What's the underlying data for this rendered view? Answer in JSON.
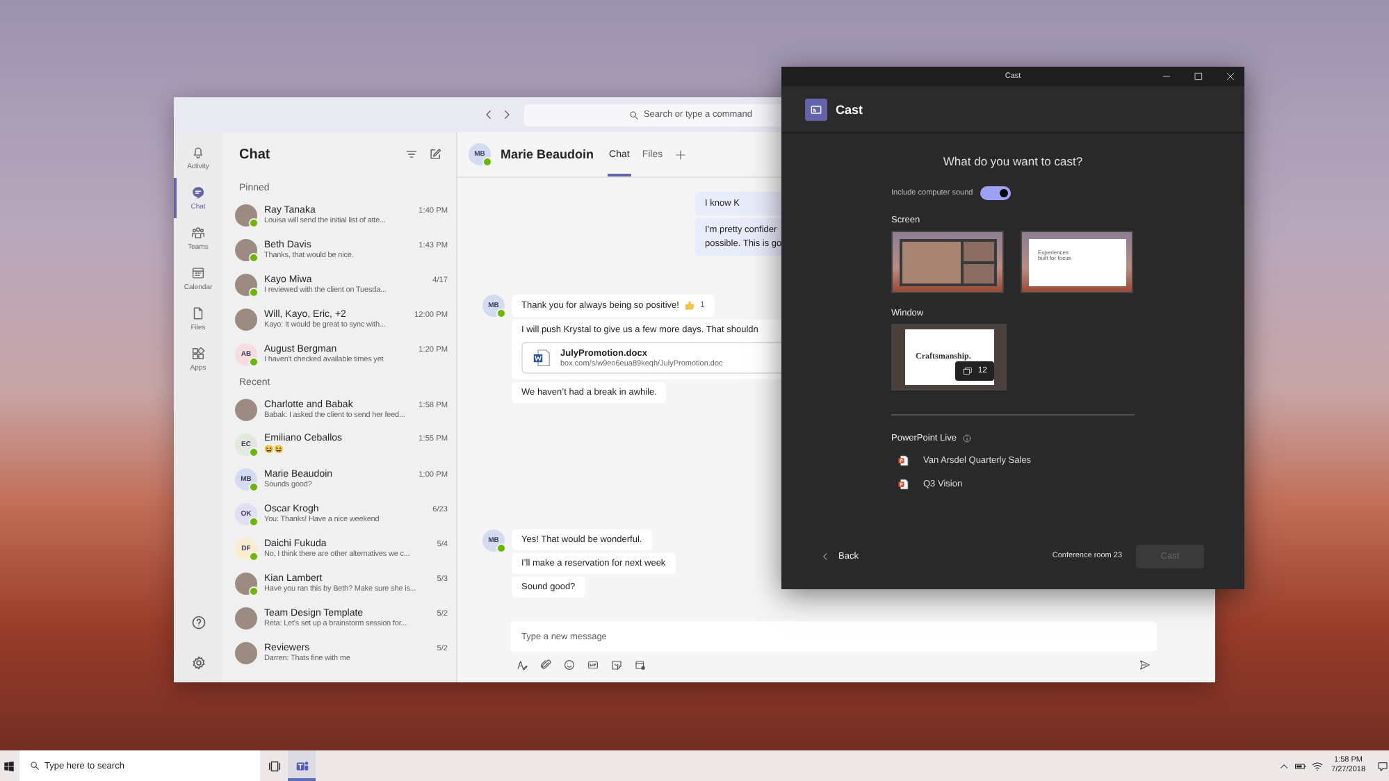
{
  "teams_window": {
    "title_bar": {
      "search_placeholder": "Search or type a command"
    },
    "rail": {
      "items": [
        {
          "label": "Activity",
          "kind": "bell",
          "selected": false
        },
        {
          "label": "Chat",
          "kind": "chat",
          "selected": true
        },
        {
          "label": "Teams",
          "kind": "teams",
          "selected": false
        },
        {
          "label": "Calendar",
          "kind": "calendar",
          "selected": false
        },
        {
          "label": "Files",
          "kind": "file",
          "selected": false
        },
        {
          "label": "Apps",
          "kind": "apps",
          "selected": false
        }
      ],
      "bottom": [
        {
          "kind": "help"
        },
        {
          "kind": "settings"
        }
      ]
    },
    "chat_list": {
      "title": "Chat",
      "sections": [
        {
          "title": "Pinned",
          "chats": [
            {
              "name": "Ray Tanaka",
              "preview": "Louisa will send the initial list of atte...",
              "time": "1:40 PM",
              "avatar": {
                "kind": "photo"
              },
              "online": true
            },
            {
              "name": "Beth Davis",
              "preview": "Thanks, that would be nice.",
              "time": "1:43 PM",
              "avatar": {
                "kind": "photo"
              },
              "online": true
            },
            {
              "name": "Kayo Miwa",
              "preview": "I reviewed with the client on Tuesda...",
              "time": "4/17",
              "avatar": {
                "kind": "photo"
              },
              "online": true
            },
            {
              "name": "Will, Kayo, Eric, +2",
              "preview": "Kayo: It would be great to sync with...",
              "time": "12:00 PM",
              "avatar": {
                "kind": "photo"
              },
              "online": false
            },
            {
              "name": "August Bergman",
              "preview": "I haven't checked available times yet",
              "time": "1:20 PM",
              "avatar": {
                "kind": "initials",
                "initials": "AB",
                "color": "#f6dde2"
              },
              "online": true
            }
          ]
        },
        {
          "title": "Recent",
          "chats": [
            {
              "name": "Charlotte and Babak",
              "preview": "Babak: I asked the client to send her feed...",
              "time": "1:58 PM",
              "avatar": {
                "kind": "photo"
              },
              "online": false
            },
            {
              "name": "Emiliano Ceballos",
              "preview": "😆😆",
              "time": "1:55 PM",
              "avatar": {
                "kind": "initials",
                "initials": "EC",
                "color": "#e1e8dc"
              },
              "online": true
            },
            {
              "name": "Marie Beaudoin",
              "preview": "Sounds good?",
              "time": "1:00 PM",
              "avatar": {
                "kind": "initials",
                "initials": "MB",
                "color": "#d3dbf0"
              },
              "online": true
            },
            {
              "name": "Oscar Krogh",
              "preview": "You: Thanks! Have a nice weekend",
              "time": "6/23",
              "avatar": {
                "kind": "initials",
                "initials": "OK",
                "color": "#e3def5"
              },
              "online": true
            },
            {
              "name": "Daichi Fukuda",
              "preview": "No, I think there are other alternatives we c...",
              "time": "5/4",
              "avatar": {
                "kind": "initials",
                "initials": "DF",
                "color": "#f8edcf"
              },
              "online": true
            },
            {
              "name": "Kian Lambert",
              "preview": "Have you ran this by Beth? Make sure she is...",
              "time": "5/3",
              "avatar": {
                "kind": "photo"
              },
              "online": true
            },
            {
              "name": "Team Design Template",
              "preview": "Reta: Let's set up a brainstorm session for...",
              "time": "5/2",
              "avatar": {
                "kind": "photo"
              },
              "online": false
            },
            {
              "name": "Reviewers",
              "preview": "Darren: Thats fine with me",
              "time": "5/2",
              "avatar": {
                "kind": "photo"
              },
              "online": false
            }
          ]
        }
      ]
    },
    "conversation": {
      "header": {
        "avatar": {
          "kind": "initials",
          "initials": "MB",
          "color": "#d3dbf0"
        },
        "online": true,
        "name": "Marie Beaudoin",
        "tabs": [
          {
            "label": "Chat",
            "selected": true
          },
          {
            "label": "Files",
            "selected": false
          }
        ]
      },
      "groups": [
        {
          "kind": "sent",
          "messages": [
            {
              "text": "I know K"
            },
            {
              "text": "I’m pretty confider\npossible. This is go"
            }
          ]
        },
        {
          "kind": "received",
          "avatar": {
            "kind": "initials",
            "initials": "MB",
            "color": "#d3dbf0"
          },
          "online": true,
          "messages": [
            {
              "text": "Thank you for always being so positive!",
              "reaction": {
                "count": "1"
              }
            },
            {
              "text": "I will push Krystal to give us a few more days. That shouldn",
              "attachment": {
                "name": "JulyPromotion.docx",
                "url": "box.com/s/w9eo6eua89keqh/JulyPromotion.doc"
              }
            },
            {
              "text": "We haven’t had a break in awhile."
            }
          ]
        },
        {
          "kind": "received",
          "avatar": {
            "kind": "initials",
            "initials": "MB",
            "color": "#d3dbf0"
          },
          "online": true,
          "messages": [
            {
              "text": "Yes! That would be wonderful."
            },
            {
              "text": "I’ll make a reservation for next week"
            },
            {
              "text": "Sound good?"
            }
          ]
        }
      ],
      "composer": {
        "placeholder": "Type a new message"
      }
    }
  },
  "cast_window": {
    "window_title": "Cast",
    "header": "Cast",
    "question": "What do you want to cast?",
    "sound_toggle": {
      "label": "Include computer sound",
      "on": true
    },
    "screen": {
      "label": "Screen",
      "thumbnails": [
        {
          "kind": "meeting"
        },
        {
          "kind": "document",
          "text": "Experiences built for focus"
        }
      ]
    },
    "window": {
      "label": "Window",
      "thumbnails": [
        {
          "kind": "slides",
          "text": "Craftsmanship.",
          "count": "12"
        }
      ]
    },
    "powerpoint": {
      "title": "PowerPoint Live",
      "items": [
        "Van Arsdel Quarterly Sales",
        "Q3 Vision"
      ]
    },
    "footer": {
      "back": "Back",
      "room": "Conference room 23",
      "cast_button": {
        "label": "Cast",
        "disabled": true
      }
    }
  },
  "taskbar": {
    "search_placeholder": "Type here to search",
    "apps": [
      {
        "kind": "task-view",
        "selected": false
      },
      {
        "kind": "teams",
        "selected": true
      }
    ],
    "time": "1:58 PM",
    "date": "7/27/2018"
  }
}
